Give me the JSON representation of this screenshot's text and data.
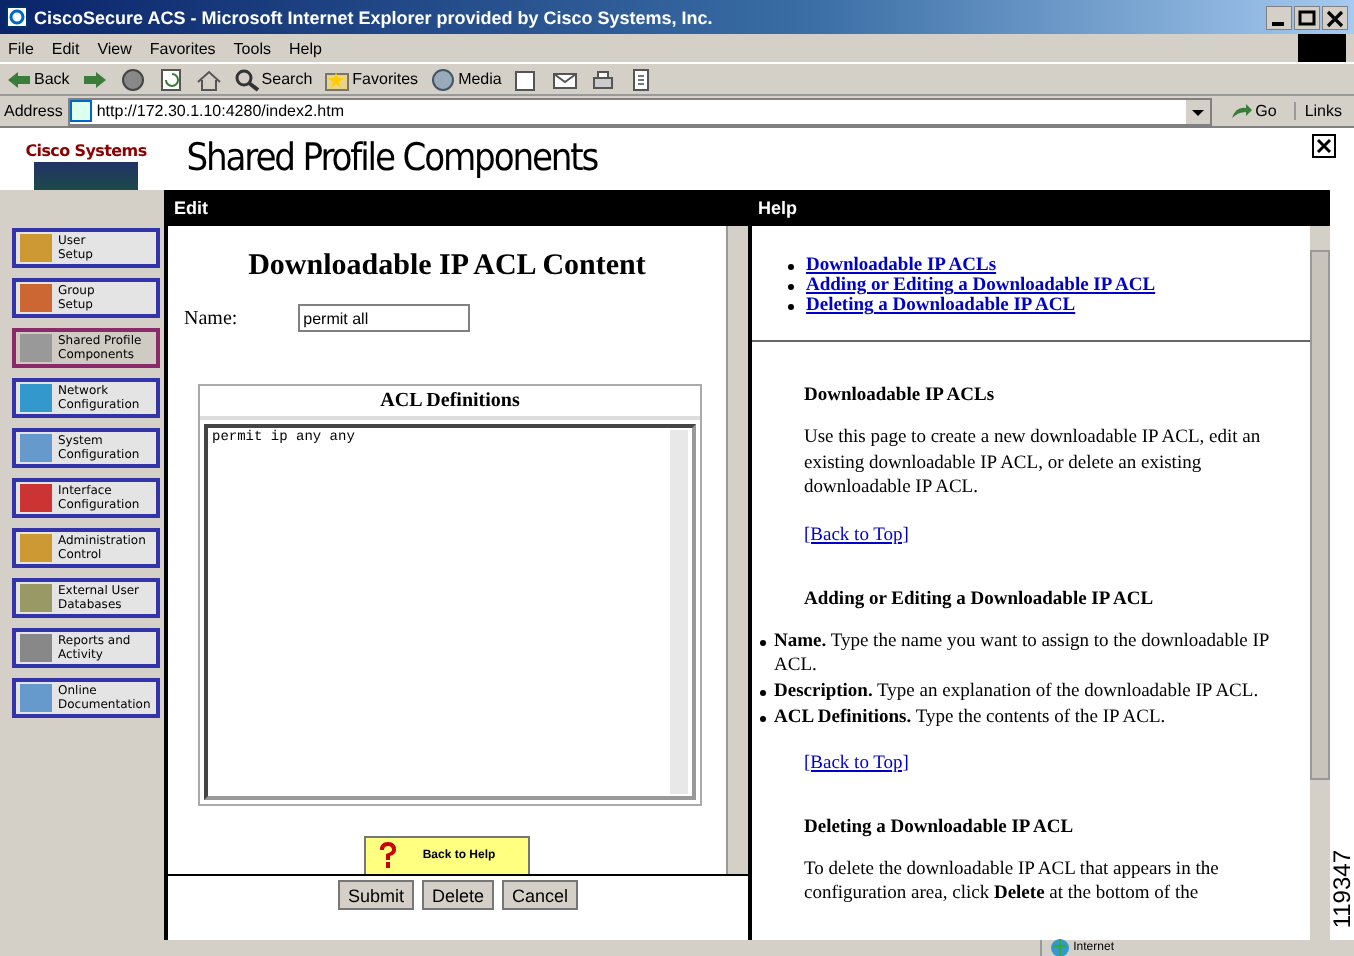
{
  "window": {
    "title": "CiscoSecure ACS - Microsoft Internet Explorer provided by Cisco Systems, Inc."
  },
  "menu": [
    "File",
    "Edit",
    "View",
    "Favorites",
    "Tools",
    "Help"
  ],
  "toolbar": [
    {
      "kind": "back",
      "label": "Back"
    },
    {
      "kind": "forward"
    },
    {
      "kind": "stop"
    },
    {
      "kind": "refresh"
    },
    {
      "kind": "home"
    },
    {
      "kind": "search",
      "label": "Search"
    },
    {
      "kind": "favorites",
      "label": "Favorites"
    },
    {
      "kind": "media",
      "label": "Media"
    },
    {
      "kind": "history"
    },
    {
      "kind": "mail"
    },
    {
      "kind": "print"
    },
    {
      "kind": "edit"
    }
  ],
  "address": {
    "label": "Address",
    "value": "http://172.30.1.10:4280/index2.htm",
    "go": "Go",
    "links": "Links"
  },
  "header": {
    "logo": "Cisco Systems",
    "title": "Shared Profile Components"
  },
  "sidebar": {
    "items": [
      {
        "label": "User\nSetup",
        "selected": false
      },
      {
        "label": "Group\nSetup",
        "selected": false
      },
      {
        "label": "Shared Profile\nComponents",
        "selected": true
      },
      {
        "label": "Network\nConfiguration",
        "selected": false
      },
      {
        "label": "System\nConfiguration",
        "selected": false
      },
      {
        "label": "Interface\nConfiguration",
        "selected": false
      },
      {
        "label": "Administration\nControl",
        "selected": false
      },
      {
        "label": "External User\nDatabases",
        "selected": false
      },
      {
        "label": "Reports and\nActivity",
        "selected": false
      },
      {
        "label": "Online\nDocumentation",
        "selected": false
      }
    ]
  },
  "edit": {
    "title": "Edit",
    "heading": "Downloadable IP ACL Content",
    "name_label": "Name:",
    "name_value": "permit all",
    "acl_title": "ACL Definitions",
    "acl_value": "permit ip any any",
    "help_button": "Back to Help",
    "buttons": [
      "Submit",
      "Delete",
      "Cancel"
    ]
  },
  "help": {
    "title": "Help",
    "links": [
      "Downloadable IP ACLs",
      "Adding or Editing a Downloadable IP ACL",
      "Deleting a Downloadable IP ACL"
    ],
    "sections": [
      {
        "heading": "Downloadable IP ACLs",
        "paragraph": "Use this page to create a new downloadable IP ACL, edit an existing downloadable IP ACL, or delete an existing downloadable IP ACL.",
        "back": "[Back to Top]"
      },
      {
        "heading": "Adding or Editing a Downloadable IP ACL",
        "bullets": [
          "**Name.** Type the name you want to assign to the downloadable IP ACL.",
          "**Description.** Type an explanation of the downloadable IP ACL.",
          "**ACL Definitions.** Type the contents of the IP ACL."
        ],
        "back": "[Back to Top]"
      },
      {
        "heading": "Deleting a Downloadable IP ACL",
        "paragraph": "To delete the downloadable IP ACL that appears in the configuration area, click **Delete** at the bottom of the"
      }
    ]
  },
  "status_bar": {
    "zone": "Internet"
  },
  "figure_number": "119347"
}
